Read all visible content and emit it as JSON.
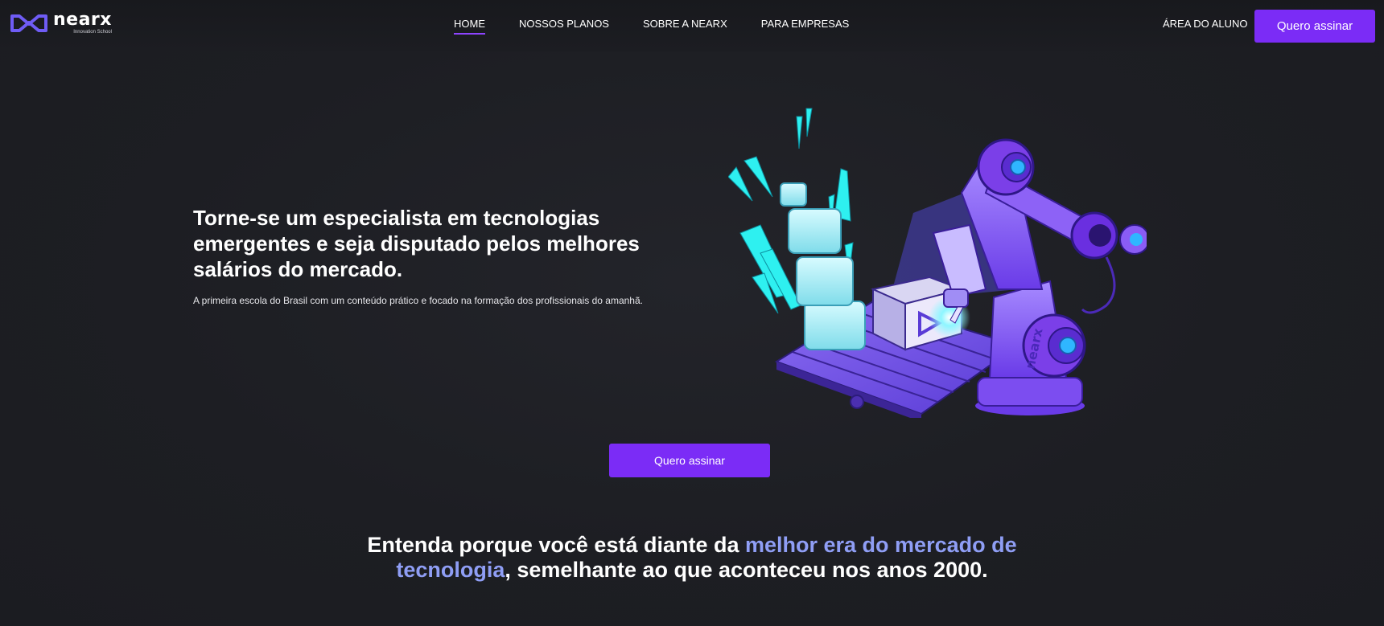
{
  "header": {
    "logo_word": "nearx",
    "logo_tagline": "Innovation School",
    "nav": [
      {
        "label": "HOME",
        "active": true
      },
      {
        "label": "NOSSOS PLANOS",
        "active": false
      },
      {
        "label": "SOBRE A NEARX",
        "active": false
      },
      {
        "label": "PARA EMPRESAS",
        "active": false
      }
    ],
    "student_area_label": "ÁREA DO ALUNO",
    "cta_label": "Quero assinar"
  },
  "hero": {
    "title": "Torne-se um especialista em tecnologias emergentes e seja disputado pelos melhores salários do mercado.",
    "subtitle": "A primeira escola do Brasil com um conteúdo prático e focado na formação dos profissionais do amanhã.",
    "illustration_label": "nearx",
    "cta_label": "Quero assinar"
  },
  "section": {
    "heading_part1": "Entenda porque você está diante da ",
    "heading_highlight": "melhor era do mercado de tecnologia",
    "heading_part2": ", semelhante ao que aconteceu nos anos 2000."
  },
  "colors": {
    "accent": "#7b2cf6",
    "highlight_text": "#8f9ef5",
    "background": "#1d1e23",
    "cyan": "#2ef0f0"
  },
  "icons": {
    "logo": "nearx-logo-icon",
    "illustration": "robot-arm-illustration"
  }
}
